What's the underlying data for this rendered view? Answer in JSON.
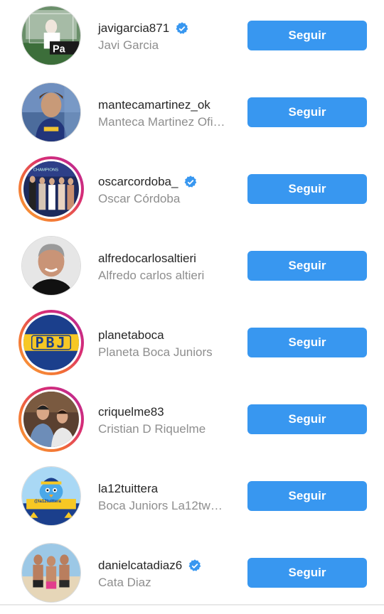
{
  "accounts": [
    {
      "username": "javigarcia871",
      "full_name": "Javi Garcia",
      "verified": true,
      "story_ring": false,
      "button": "Seguir"
    },
    {
      "username": "mantecamartinez_ok",
      "full_name": "Manteca Martinez Ofi…",
      "verified": false,
      "story_ring": false,
      "button": "Seguir"
    },
    {
      "username": "oscarcordoba_",
      "full_name": "Oscar Córdoba",
      "verified": true,
      "story_ring": true,
      "button": "Seguir"
    },
    {
      "username": "alfredocarlosaltieri",
      "full_name": "Alfredo carlos altieri",
      "verified": false,
      "story_ring": false,
      "button": "Seguir"
    },
    {
      "username": "planetaboca",
      "full_name": "Planeta Boca Juniors",
      "verified": false,
      "story_ring": true,
      "button": "Seguir",
      "avatar_text": "PBJ"
    },
    {
      "username": "criquelme83",
      "full_name": "Cristian D Riquelme",
      "verified": false,
      "story_ring": true,
      "button": "Seguir"
    },
    {
      "username": "la12tuittera",
      "full_name": "Boca Juniors La12tw…",
      "verified": false,
      "story_ring": false,
      "button": "Seguir",
      "avatar_text": "@la12tuittera"
    },
    {
      "username": "danielcatadiaz6",
      "full_name": "Cata Diaz",
      "verified": true,
      "story_ring": false,
      "button": "Seguir"
    }
  ],
  "colors": {
    "button": "#3897f0",
    "verified": "#3897f0",
    "username": "#262626",
    "fullname": "#8e8e8e"
  }
}
